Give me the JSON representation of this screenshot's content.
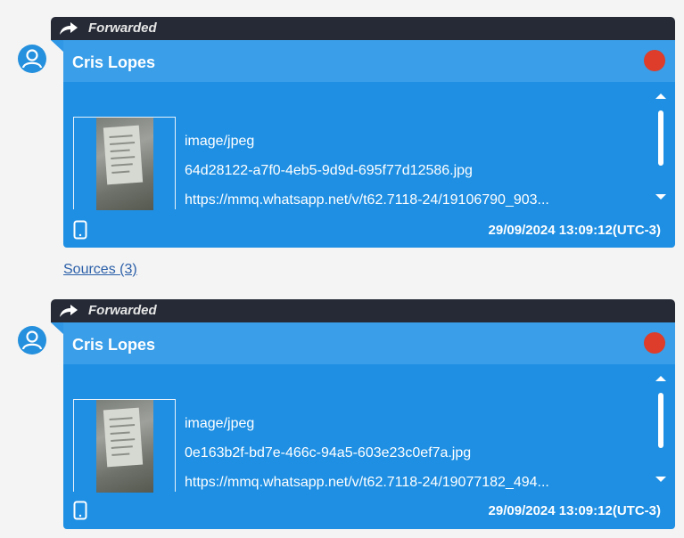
{
  "messages": [
    {
      "forwarded_label": "Forwarded",
      "sender": "Cris Lopes",
      "mime_type": "image/jpeg",
      "filename": "64d28122-a7f0-4eb5-9d9d-695f77d12586.jpg",
      "url": "https://mmq.whatsapp.net/v/t62.7118-24/19106790_903...",
      "timestamp": "29/09/2024 13:09:12(UTC-3)",
      "status_color": "#dd3d2a"
    },
    {
      "forwarded_label": "Forwarded",
      "sender": "Cris Lopes",
      "mime_type": "image/jpeg",
      "filename": "0e163b2f-bd7e-466c-94a5-603e23c0ef7a.jpg",
      "url": "https://mmq.whatsapp.net/v/t62.7118-24/19077182_494...",
      "timestamp": "29/09/2024 13:09:12(UTC-3)",
      "status_color": "#dd3d2a"
    }
  ],
  "sources_link": "Sources (3)",
  "icons": {
    "forward": "forward-arrow-icon",
    "avatar": "user-avatar-icon",
    "device": "phone-icon"
  },
  "colors": {
    "card_blue": "#1e8fe3",
    "header_blue": "#3a9ee8",
    "forward_bar": "#252a36",
    "status_red": "#dd3d2a"
  }
}
